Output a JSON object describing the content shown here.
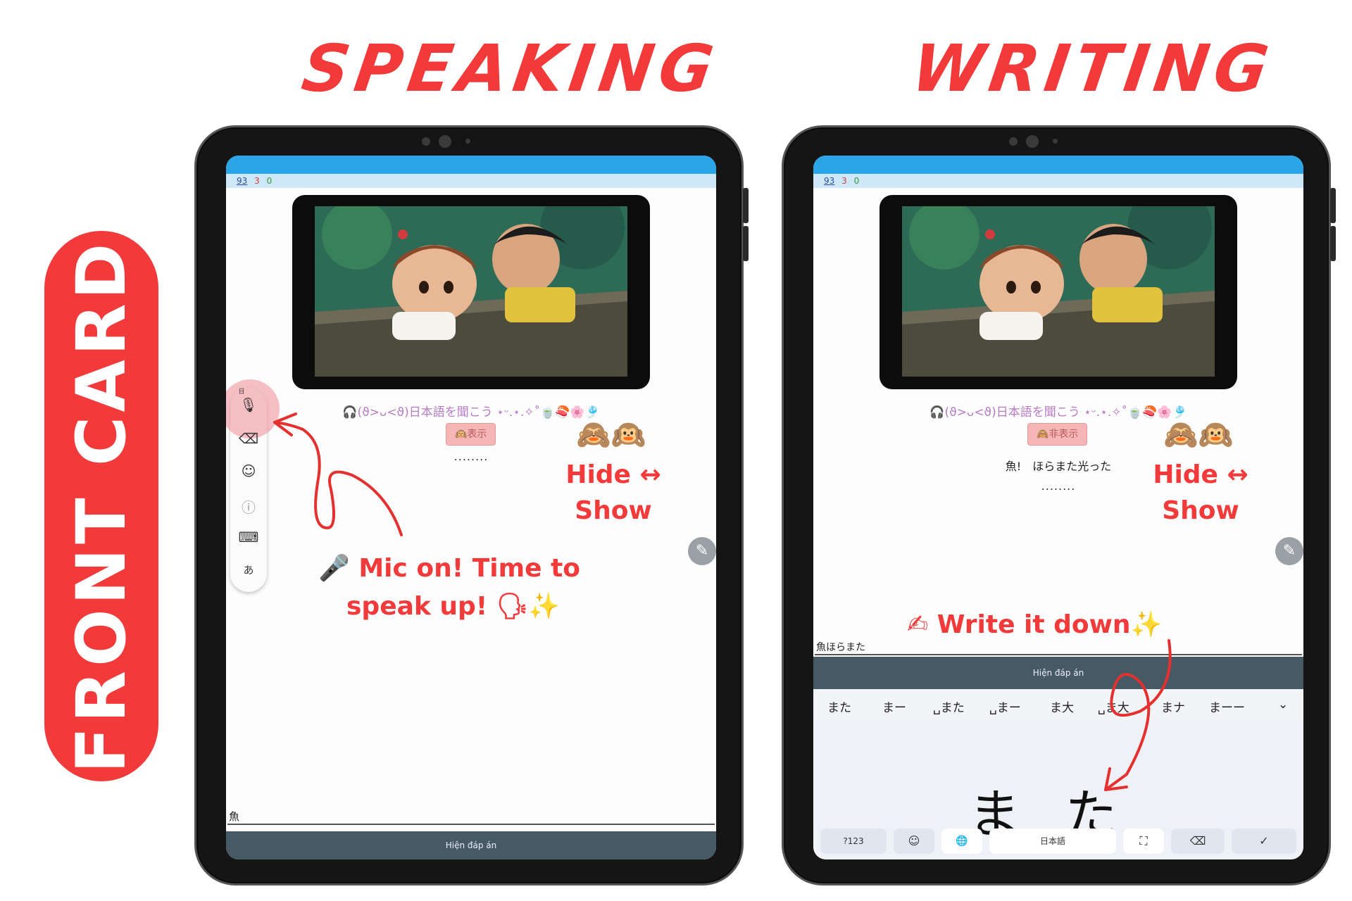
{
  "titles": {
    "left": "SPEAKING",
    "right": "WRITING",
    "side": "FRONT CARD"
  },
  "status": {
    "count_new": "93",
    "count_learn": "3",
    "count_review": "0"
  },
  "card": {
    "kaomoji": "🎧(ϑ>ᴗ<ϑ)日本語を聞こう ⋆ᵕ.⋆.✧˚🍵🍣🌸🎐",
    "show_button": "🙉表示",
    "hide_button": "🙈非表示",
    "placeholder_dots": "........",
    "sentence": "魚!　ほらまた光った",
    "reveal_bar": "Hiện đáp án"
  },
  "speaking": {
    "answer_text": "魚",
    "toolbar": {
      "mic_icon": "🎙",
      "backspace_icon": "⌫",
      "emoji_icon": "☺",
      "info_icon": "ⓘ",
      "keyboard_icon": "⌨",
      "kana_label": "あ",
      "indicator": "日"
    }
  },
  "writing": {
    "answer_text": "魚ほらまた",
    "suggestions": [
      "また",
      "まー",
      "␣また",
      "␣まー",
      "ま大",
      "␣ま大",
      "まナ",
      "まーー"
    ],
    "handwriting": "ま た",
    "keys": {
      "symbols": "?123",
      "emoji": "☺",
      "globe": "🌐",
      "space": "日本語",
      "fullscreen": "⛶",
      "backspace": "⌫",
      "enter": "✓"
    }
  },
  "annotations": {
    "monkeys": "🙈🙉",
    "hide_show_line1": "Hide ↔",
    "hide_show_line2": "Show",
    "mic_line1": "🎤 Mic on! Time to",
    "mic_line2": "speak up! 🗣✨",
    "write": "✍ Write it down✨"
  },
  "colors": {
    "accent": "#f23a3a",
    "status_bar": "#2aa6e8",
    "reveal_bar": "#455a64"
  }
}
